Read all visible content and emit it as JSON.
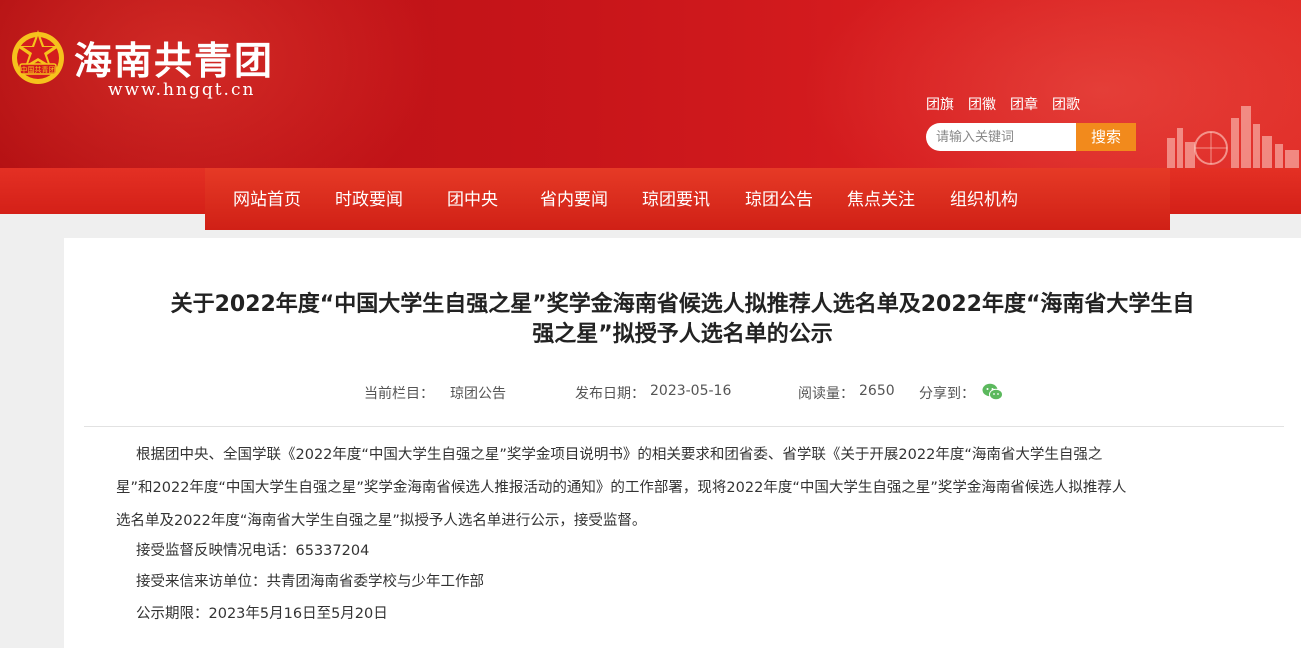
{
  "header": {
    "site_title": "海南共青团",
    "site_url": "www.hngqt.cn",
    "emblem_text": "中国共青团",
    "quick_links": [
      "团旗",
      "团徽",
      "团章",
      "团歌"
    ],
    "search_placeholder": "请输入关键词",
    "search_button": "搜索"
  },
  "nav": {
    "items": [
      "网站首页",
      "时政要闻",
      "团中央",
      "省内要闻",
      "琼团要讯",
      "琼团公告",
      "焦点关注",
      "组织机构"
    ]
  },
  "article": {
    "title_line1": "关于2022年度“中国大学生自强之星”奖学金海南省候选人拟推荐人选名单及2022年度“海南省大学生自",
    "title_line2": "强之星”拟授予人选名单的公示",
    "meta": {
      "column_label": "当前栏目：",
      "column_value": "琼团公告",
      "date_label": "发布日期：",
      "date_value": "2023-05-16",
      "reads_label": "阅读量：",
      "reads_value": "2650",
      "share_label": "分享到："
    },
    "body_line1": "根据团中央、全国学联《2022年度“中国大学生自强之星”奖学金项目说明书》的相关要求和团省委、省学联《关于开展2022年度“海南省大学生自强之",
    "body_line2": "星”和2022年度“中国大学生自强之星”奖学金海南省候选人推报活动的通知》的工作部署，现将2022年度“中国大学生自强之星”奖学金海南省候选人拟推荐人",
    "body_line3": "选名单及2022年度“海南省大学生自强之星”拟授予人选名单进行公示，接受监督。",
    "phone": "接受监督反映情况电话：65337204",
    "unit": "接受来信来访单位：共青团海南省委学校与少年工作部",
    "period": "公示期限：2023年5月16日至5月20日"
  },
  "colors": {
    "primary_red": "#c8151a",
    "search_orange": "#f28a1c",
    "wechat_green": "#5bb85d"
  }
}
